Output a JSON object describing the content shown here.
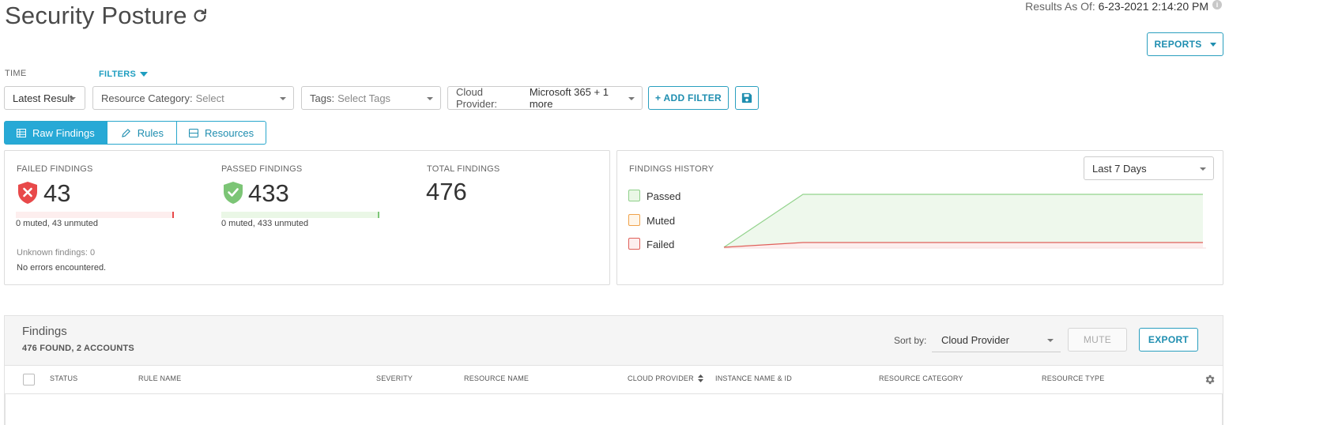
{
  "header": {
    "title": "Security Posture",
    "results_label": "Results As Of:",
    "results_value": "6-23-2021 2:14:20 PM",
    "info_glyph": "i",
    "reports_label": "REPORTS"
  },
  "filters": {
    "time_label": "TIME",
    "filters_label": "FILTERS",
    "time_value": "Latest Result",
    "resource_category_label": "Resource Category:",
    "resource_category_placeholder": "Select",
    "tags_label": "Tags:",
    "tags_placeholder": "Select Tags",
    "cloud_provider_label": "Cloud Provider:",
    "cloud_provider_value": "Microsoft 365 + 1 more",
    "add_filter_label": "+ ADD FILTER"
  },
  "tabs": [
    {
      "label": "Raw Findings",
      "icon": "table-icon",
      "active": true
    },
    {
      "label": "Rules",
      "icon": "pencil-icon",
      "active": false
    },
    {
      "label": "Resources",
      "icon": "server-icon",
      "active": false
    }
  ],
  "summary": {
    "failed_label": "FAILED FINDINGS",
    "failed_count": "43",
    "failed_detail": "0 muted, 43 unmuted",
    "failed_fraction": 1.0,
    "passed_label": "PASSED FINDINGS",
    "passed_count": "433",
    "passed_detail": "0 muted, 433 unmuted",
    "passed_fraction": 1.0,
    "total_label": "TOTAL FINDINGS",
    "total_count": "476",
    "unknown_label": "Unknown findings:",
    "unknown_count": "0",
    "errors_text": "No errors encountered."
  },
  "history": {
    "label": "FINDINGS HISTORY",
    "range_value": "Last 7 Days",
    "legend": [
      {
        "name": "Passed",
        "fill": "#eaf7e6",
        "stroke": "#8fd08a"
      },
      {
        "name": "Muted",
        "fill": "#fff6ea",
        "stroke": "#f0a24a"
      },
      {
        "name": "Failed",
        "fill": "#fdeeee",
        "stroke": "#e0605a"
      }
    ]
  },
  "findings": {
    "title": "Findings",
    "count_text": "476 FOUND, 2 ACCOUNTS",
    "sort_label": "Sort by:",
    "sort_value": "Cloud Provider",
    "mute_label": "MUTE",
    "export_label": "EXPORT",
    "columns": [
      "STATUS",
      "RULE NAME",
      "SEVERITY",
      "RESOURCE NAME",
      "CLOUD PROVIDER",
      "INSTANCE NAME & ID",
      "RESOURCE CATEGORY",
      "RESOURCE TYPE"
    ]
  },
  "colors": {
    "accent": "#27a9d6",
    "failed": "#e8494a",
    "passed": "#7cc576"
  }
}
